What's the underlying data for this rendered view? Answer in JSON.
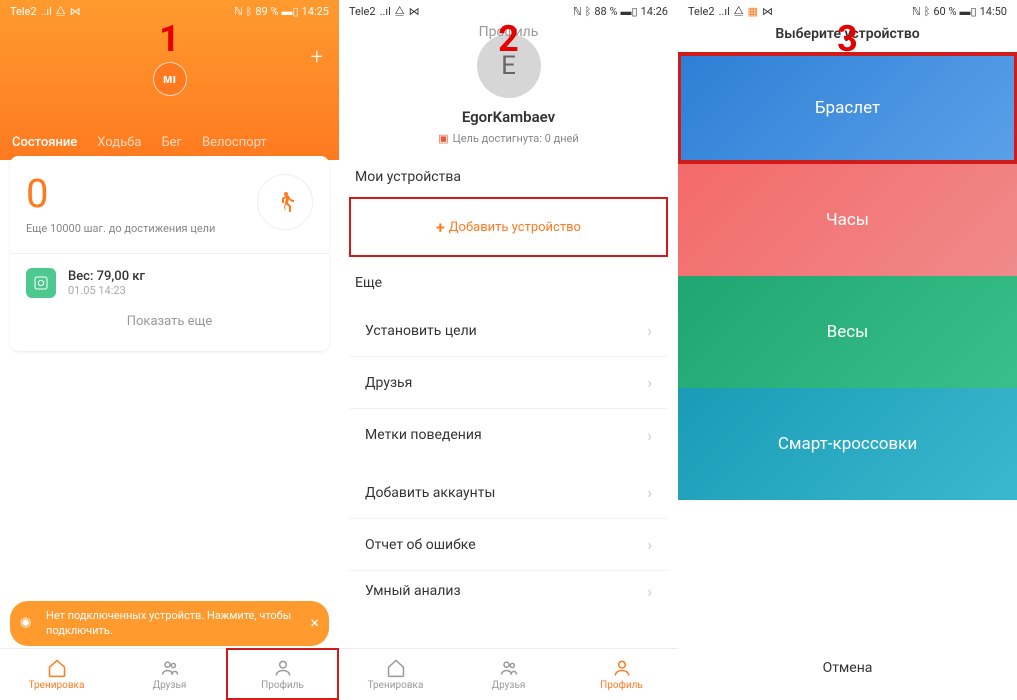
{
  "phone1": {
    "status": {
      "carrier": "Tele2",
      "signal": "..ıl",
      "wifi": "⧋",
      "link": "⋈",
      "nfc": "ℕ",
      "bt": "ᛒ",
      "battery_pct": "89 %",
      "battery_icon": "▬▯",
      "time": "14:25"
    },
    "step_num": "1",
    "tabs": {
      "state": "Состояние",
      "walk": "Ходьба",
      "run": "Бег",
      "cycle": "Велоспорт"
    },
    "steps": {
      "count": "0",
      "goal": "Еще 10000 шаг. до достижения цели"
    },
    "weight": {
      "label": "Вес: 79,00  кг",
      "date": "01.05 14:23"
    },
    "show_more": "Показать еще",
    "toast": "Нет подключенных устройств. Нажмите, чтобы подключить.",
    "nav": {
      "workout": "Тренировка",
      "friends": "Друзья",
      "profile": "Профиль"
    }
  },
  "phone2": {
    "status": {
      "carrier": "Tele2",
      "signal": "..ıl",
      "wifi": "⧋",
      "link": "⋈",
      "nfc": "ℕ",
      "bt": "ᛒ",
      "battery_pct": "88 %",
      "battery_icon": "▬▯",
      "time": "14:26"
    },
    "step_num": "2",
    "title": "Профиль",
    "avatar_letter": "E",
    "name": "EgorKambaev",
    "goal_text": "Цель достигнута: 0 дней",
    "my_devices": "Мои устройства",
    "add_device": "Добавить устройство",
    "more": "Еще",
    "items1": {
      "goals": "Установить цели",
      "friends": "Друзья",
      "behavior": "Метки поведения"
    },
    "items2": {
      "accounts": "Добавить аккаунты",
      "bug": "Отчет об ошибке",
      "smart": "Умный анализ"
    },
    "nav": {
      "workout": "Тренировка",
      "friends": "Друзья",
      "profile": "Профиль"
    }
  },
  "phone3": {
    "status": {
      "carrier": "Tele2",
      "signal": "..ıl",
      "wifi": "⧋",
      "sim": "▦",
      "link": "⋈",
      "nfc": "ℕ",
      "bt": "ᛒ",
      "battery_pct": "60 %",
      "battery_icon": "▬▯",
      "time": "14:50"
    },
    "step_num": "3",
    "title": "Выберите устройство",
    "tiles": {
      "band": "Браслет",
      "watch": "Часы",
      "scale": "Весы",
      "shoes": "Смарт-кроссовки"
    },
    "cancel": "Отмена"
  }
}
